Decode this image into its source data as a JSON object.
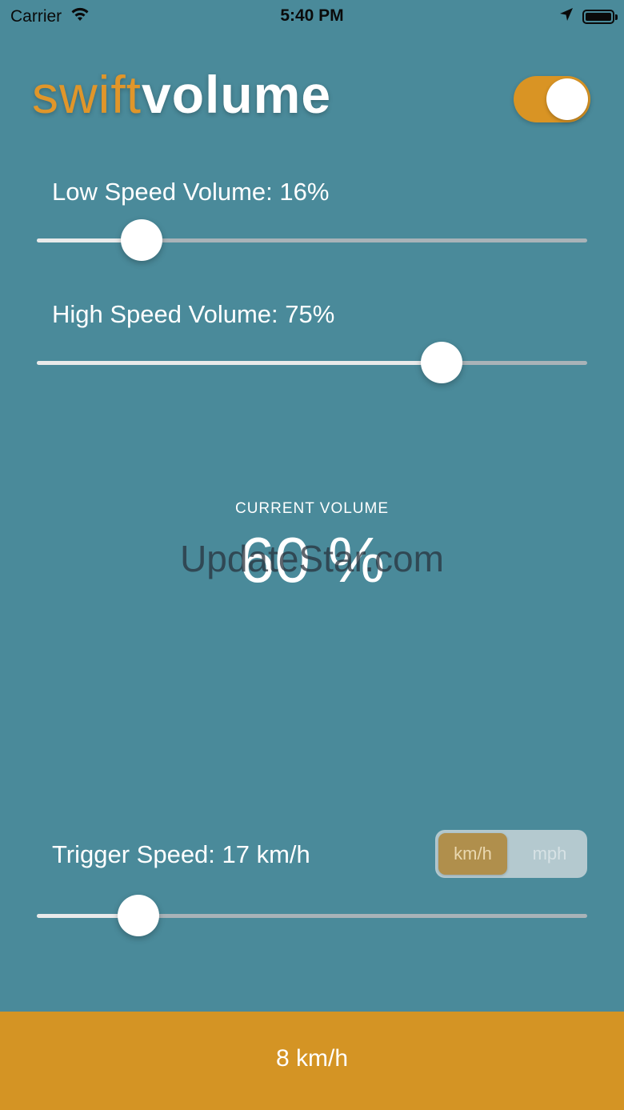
{
  "status_bar": {
    "carrier": "Carrier",
    "time": "5:40 PM",
    "icons": [
      "wifi-icon",
      "location-arrow-icon",
      "battery-icon"
    ]
  },
  "logo": {
    "part1": "swift",
    "part2": "volume"
  },
  "toggle": {
    "state": "on",
    "color": "#d99424"
  },
  "low_speed": {
    "label": "Low Speed Volume: 16%",
    "value_fraction": 0.19
  },
  "high_speed": {
    "label": "High Speed Volume: 75%",
    "value_fraction": 0.735
  },
  "current_volume": {
    "label": "CURRENT VOLUME",
    "value": "60 %"
  },
  "watermark": "UpdateStar.com",
  "trigger": {
    "label": "Trigger Speed: 17 km/h",
    "value_fraction": 0.185
  },
  "units": {
    "options": [
      "km/h",
      "mph"
    ],
    "selected": "km/h"
  },
  "bottom": {
    "speed": "8 km/h"
  },
  "colors": {
    "background": "#4a8a9a",
    "accent": "#d49424",
    "slider_track": "#a9b3b8",
    "slider_fill": "#e9eaea"
  }
}
